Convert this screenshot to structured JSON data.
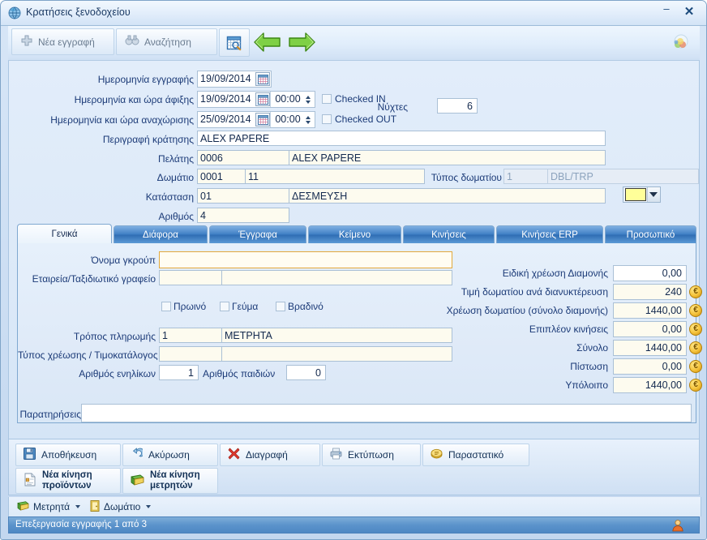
{
  "window": {
    "title": "Κρατήσεις ξενοδοχείου",
    "icon": "globe-icon",
    "minimize_label": "–",
    "close_label": "✕"
  },
  "toolbar": {
    "new_label": "Νέα εγγραφή",
    "search_label": "Αναζήτηση",
    "calendar_icon": "calendar-search-icon",
    "prev_icon": "arrow-left-green-icon",
    "next_icon": "arrow-right-green-icon",
    "corner_icon": "globe-icon"
  },
  "form": {
    "entry_date_label": "Ημερομηνία εγγραφής",
    "entry_date_value": "19/09/2014",
    "arrival_label": "Ημερομηνία και ώρα άφιξης",
    "arrival_date_value": "19/09/2014",
    "arrival_time_value": "00:00",
    "checked_in_label": "Checked IN",
    "checked_in": false,
    "departure_label": "Ημερομηνία  και ώρα αναχώρισης",
    "departure_date_value": "25/09/2014",
    "departure_time_value": "00:00",
    "checked_out_label": "Checked OUT",
    "checked_out": false,
    "nights_label": "Νύχτες",
    "nights_value": "6",
    "description_label": "Περιγραφή κράτησης",
    "description_value": "ALEX PAPERE",
    "customer_label": "Πελάτης",
    "customer_code": "0006",
    "customer_name": "ALEX PAPERE",
    "room_label": "Δωμάτιο",
    "room_code": "0001",
    "room_name": "11",
    "room_type_label": "Τύπος δωματίου",
    "room_type_code": "1",
    "room_type_name": "DBL/TRP",
    "status_label": "Κατάσταση",
    "status_code": "01",
    "status_name": "ΔΕΣΜΕΥΣΗ",
    "number_label": "Αριθμός",
    "number_value": "4",
    "color_swatch": "#ffff99"
  },
  "tabs": [
    {
      "label": "Γενικά",
      "active": true
    },
    {
      "label": "Διάφορα",
      "active": false
    },
    {
      "label": "Έγγραφα",
      "active": false
    },
    {
      "label": "Κείμενο",
      "active": false
    },
    {
      "label": "Κινήσεις",
      "active": false
    },
    {
      "label": "Κινήσεις ERP",
      "active": false
    },
    {
      "label": "Προσωπικό",
      "active": false
    }
  ],
  "general_tab": {
    "group_name_label": "Όνομα γκρούπ",
    "group_name_value": "",
    "agency_label": "Εταιρεία/Ταξιδιωτικό γραφείο",
    "agency_code": "",
    "agency_name": "",
    "breakfast_label": "Πρωινό",
    "breakfast": false,
    "lunch_label": "Γεύμα",
    "lunch": false,
    "dinner_label": "Βραδινό",
    "dinner": false,
    "payment_label": "Τρόπος πληρωμής",
    "payment_code": "1",
    "payment_name": "ΜΕΤΡΗΤΑ",
    "charge_type_label": "Τύπος χρέωσης / Τιμοκατάλογος",
    "charge_type_code": "",
    "charge_type_name": "",
    "adults_label": "Αριθμός  ενηλίκων",
    "adults_value": "1",
    "children_label": "Αριθμός  παιδιών",
    "children_value": "0",
    "notes_label": "Παρατηρήσεις",
    "notes_value": ""
  },
  "money": {
    "rows": [
      {
        "label": "Ειδική χρέωση Διαμονής",
        "value": "0,00",
        "euro": false
      },
      {
        "label": "Τιμή δωματίου ανά διανυκτέρευση",
        "value": "240",
        "euro": true
      },
      {
        "label": "Χρέωση δωματίου (σύνολο διαμονής)",
        "value": "1440,00",
        "euro": true
      },
      {
        "label": "Επιπλέον κινήσεις",
        "value": "0,00",
        "euro": true
      },
      {
        "label": "Σύνολο",
        "value": "1440,00",
        "euro": true
      },
      {
        "label": "Πίστωση",
        "value": "0,00",
        "euro": true
      },
      {
        "label": "Υπόλοιπο",
        "value": "1440,00",
        "euro": true
      }
    ],
    "euro_symbol": "€"
  },
  "actions": {
    "save_label": "Αποθήκευση",
    "cancel_label": "Ακύρωση",
    "delete_label": "Διαγραφή",
    "print_label": "Εκτύπωση",
    "document_label": "Παραστατικό",
    "new_product_move_line1": "Νέα κίνηση",
    "new_product_move_line2": "προϊόντων",
    "new_cash_move_line1": "Νέα κίνηση",
    "new_cash_move_line2": "μετρητών"
  },
  "menubar": {
    "cash_label": "Μετρητά",
    "room_label": "Δωμάτιο"
  },
  "statusbar": {
    "text": "Επεξεργασία εγγραφής 1 από 3",
    "user_icon": "user-icon"
  }
}
